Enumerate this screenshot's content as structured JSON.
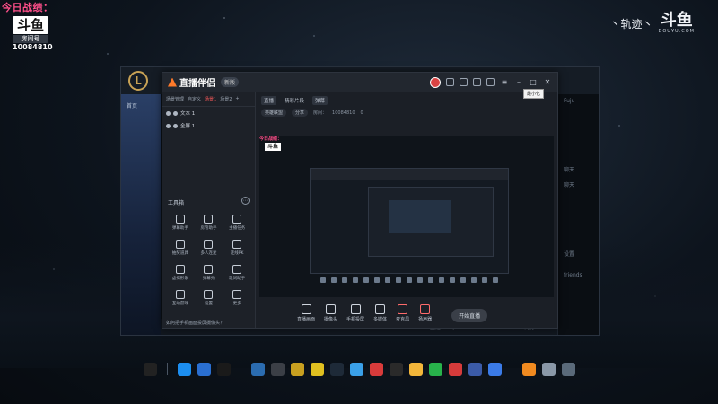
{
  "overlay": {
    "title": "今日战绩：",
    "logo_text": "斗鱼",
    "room_label": "房间号",
    "room_number": "10084810"
  },
  "brand": {
    "track": "丶轨迹丶",
    "logo": "斗鱼",
    "domain": "DOUYU.COM"
  },
  "bg_window": {
    "logo_letter": "L",
    "nav_item": "首页",
    "side_rows": [
      "Fuju",
      "",
      "",
      "",
      "聊天",
      "聊天",
      "",
      "",
      "",
      "",
      "",
      "",
      "设置",
      "",
      "",
      "",
      "friends"
    ],
    "status": [
      "直播 0KB/s",
      "0FPS",
      "CPU 0%",
      "内存 0%"
    ]
  },
  "app": {
    "name": "直播伴侣",
    "version": "新版",
    "tooltip": "最小化",
    "tabs": [
      "场景管理",
      "自定义",
      "场景1",
      "场景2"
    ],
    "active_tab_index": 2,
    "scene_items": [
      "文本 1",
      "全屏 1"
    ],
    "subtabs": [
      "直播",
      "精彩片段",
      "弹幕"
    ],
    "info": {
      "category": "英雄联盟",
      "edit": "分享",
      "room_label": "房间：",
      "room_id": "10084810",
      "count": "0"
    },
    "tools_title": "工具箱",
    "tools": [
      "弹幕助手",
      "房管助手",
      "主播任务",
      "抽奖道具",
      "多人连麦",
      "连线PK",
      "虚拟形象",
      "弹幕秀",
      "歌词助手",
      "互动游戏",
      "设置",
      "更多"
    ],
    "left_footer": "如何把手机画面投屏摄像头？",
    "controls": [
      "直播画面",
      "摄像头",
      "手机投屏",
      "多媒体",
      "麦克风",
      "扬声器"
    ],
    "start_button": "开始直播",
    "preview_overlay_title": "今日战绩：",
    "preview_overlay_logo": "斗鱼"
  },
  "taskbar": {
    "icons": [
      "capcut-icon",
      "edge-icon",
      "search-icon",
      "game-icon",
      "browser-icon",
      "steam-icon",
      "wow-icon",
      "wegame-icon",
      "steam2-icon",
      "feishu-icon",
      "wps-icon",
      "qq-icon",
      "emoji-icon",
      "wechat-icon",
      "netease-icon",
      "mail-icon",
      "baidu-icon",
      "folder-icon",
      "recycle-icon",
      "screen-icon"
    ],
    "colors": [
      "#222222",
      "#1c8ef0",
      "#2a6fd1",
      "#1a1a1a",
      "#2b6cb0",
      "#3b3f46",
      "#c8a020",
      "#e0c020",
      "#1e2a38",
      "#3aa0e8",
      "#d83b3b",
      "#2a2a2a",
      "#f3b63a",
      "#28b24b",
      "#d63b3b",
      "#3b5ba8",
      "#3b7be8",
      "#f08a20",
      "#8a98a8",
      "#5a6a7a"
    ]
  }
}
